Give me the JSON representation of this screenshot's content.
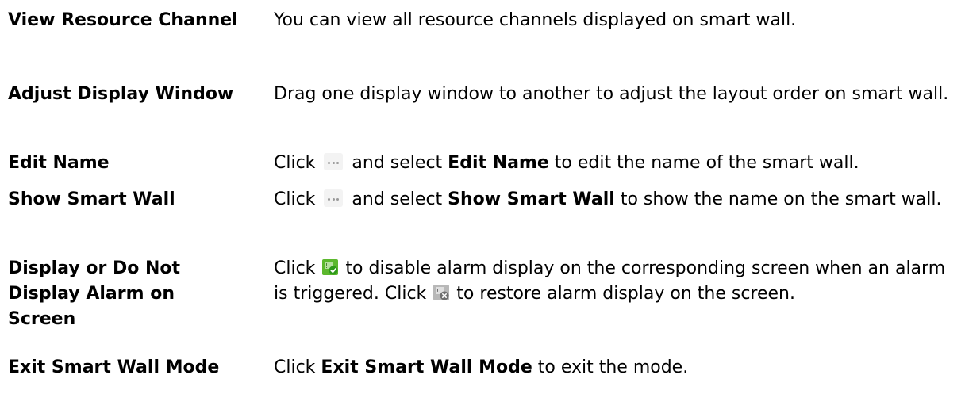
{
  "rows": [
    {
      "term": "View Resource Channel",
      "desc": {
        "text": "You can view all resource channels displayed on smart wall."
      }
    },
    {
      "term": "Adjust Display Window",
      "desc": {
        "text": "Drag one display window to another to adjust the layout order on smart wall."
      }
    },
    {
      "term": "Edit Name",
      "desc": {
        "pre": "Click",
        "mid": "and select",
        "bold": "Edit Name",
        "post": "to edit the name of the smart wall."
      }
    },
    {
      "term": "Show Smart Wall",
      "desc": {
        "pre": "Click",
        "mid": "and select",
        "bold": "Show Smart Wall",
        "post": "to show the name on the smart wall."
      }
    },
    {
      "term": "Display or Do Not Display Alarm on Screen",
      "desc": {
        "pre": "Click",
        "mid": "to disable alarm display on the corresponding screen when an alarm is triggered. Click",
        "post": "to restore alarm display on the screen."
      }
    },
    {
      "term": "Exit Smart Wall Mode",
      "desc": {
        "pre": "Click",
        "bold": "Exit Smart Wall Mode",
        "post": "to exit the mode."
      }
    }
  ],
  "icons": {
    "more": "more-options-icon",
    "alarm_on": "alarm-display-enabled-icon",
    "alarm_off": "alarm-display-disabled-icon"
  },
  "colors": {
    "alarm_on_bg": "#5cb82e",
    "alarm_off_bg": "#b8b8b8",
    "alarm_off_badge": "#6f6f6f",
    "more_icon_bg": "#f3f3f3"
  }
}
